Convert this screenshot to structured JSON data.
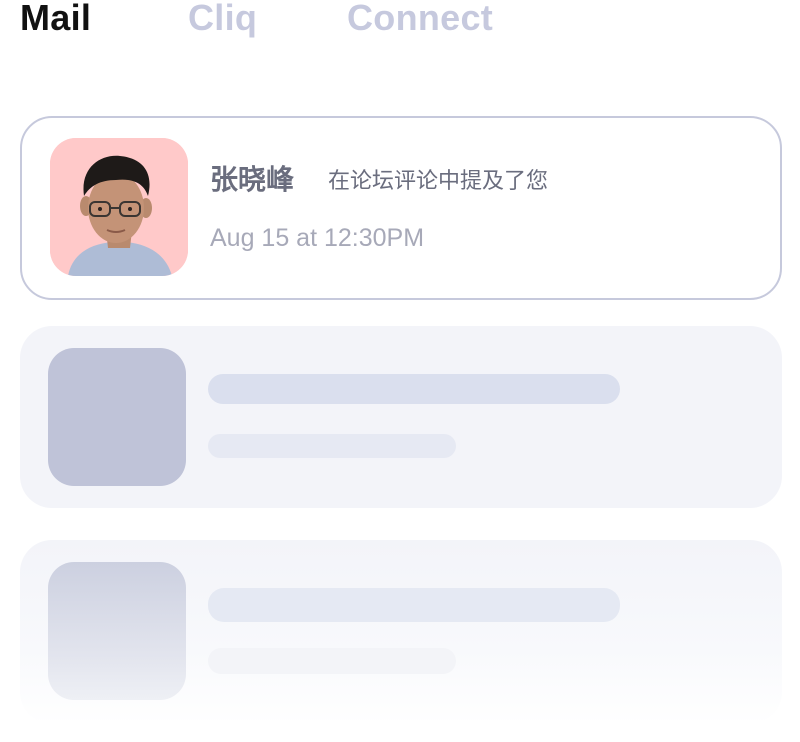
{
  "tabs": [
    {
      "label": "Mail",
      "active": true
    },
    {
      "label": "Cliq",
      "active": false
    },
    {
      "label": "Connect",
      "active": false
    }
  ],
  "notifications": [
    {
      "sender": "张晓峰",
      "action": "在论坛评论中提及了您",
      "time": "Aug 15 at 12:30PM",
      "avatar_icon": "person-photo"
    }
  ],
  "placeholders": 2,
  "colors": {
    "active_tab": "#111111",
    "inactive_tab": "#c6c9de",
    "card_border": "#c6c9dc",
    "avatar_bg": "#ffc9c9",
    "skeleton_bg": "#f3f4f9"
  }
}
